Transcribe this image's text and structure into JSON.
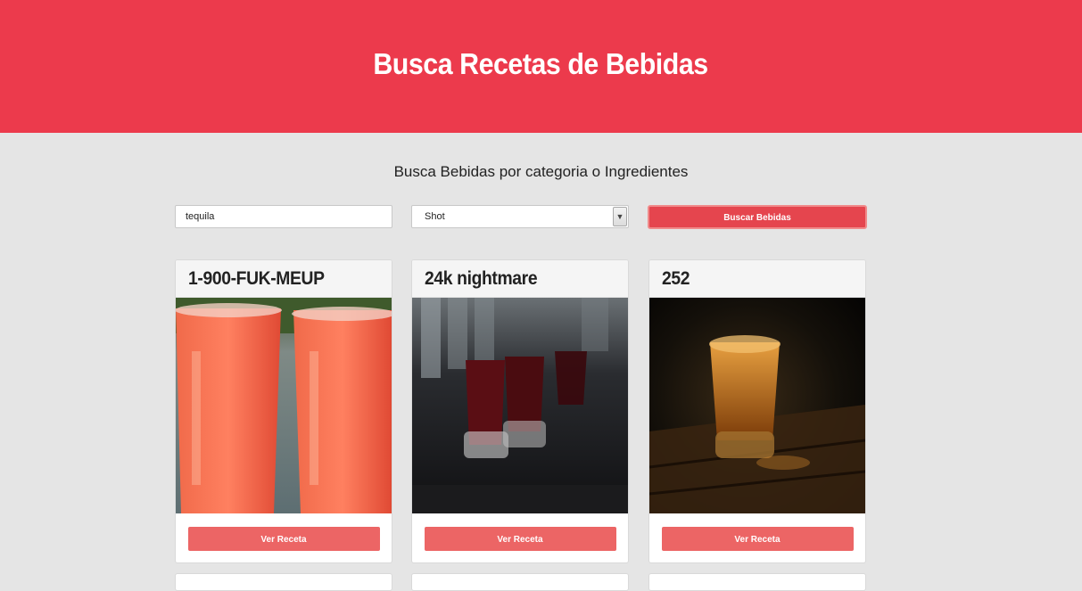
{
  "header": {
    "title": "Busca Recetas de Bebidas"
  },
  "search": {
    "subtitle": "Busca Bebidas por categoria o Ingredientes",
    "ingredient_value": "tequila",
    "category_value": "Shot",
    "button_label": "Buscar Bebidas"
  },
  "drinks": [
    {
      "name": "1-900-FUK-MEUP",
      "image": "two-red-drinks-in-plastic-cups",
      "button_label": "Ver Receta"
    },
    {
      "name": "24k nightmare",
      "image": "dark-red-shots-on-bar",
      "button_label": "Ver Receta"
    },
    {
      "name": "252",
      "image": "amber-shot-glass-on-wood",
      "button_label": "Ver Receta"
    }
  ],
  "colors": {
    "header_background": "#ec3a4c",
    "page_background": "#e5e5e5",
    "search_button": "#e5454e",
    "card_button": "#ec6565"
  }
}
